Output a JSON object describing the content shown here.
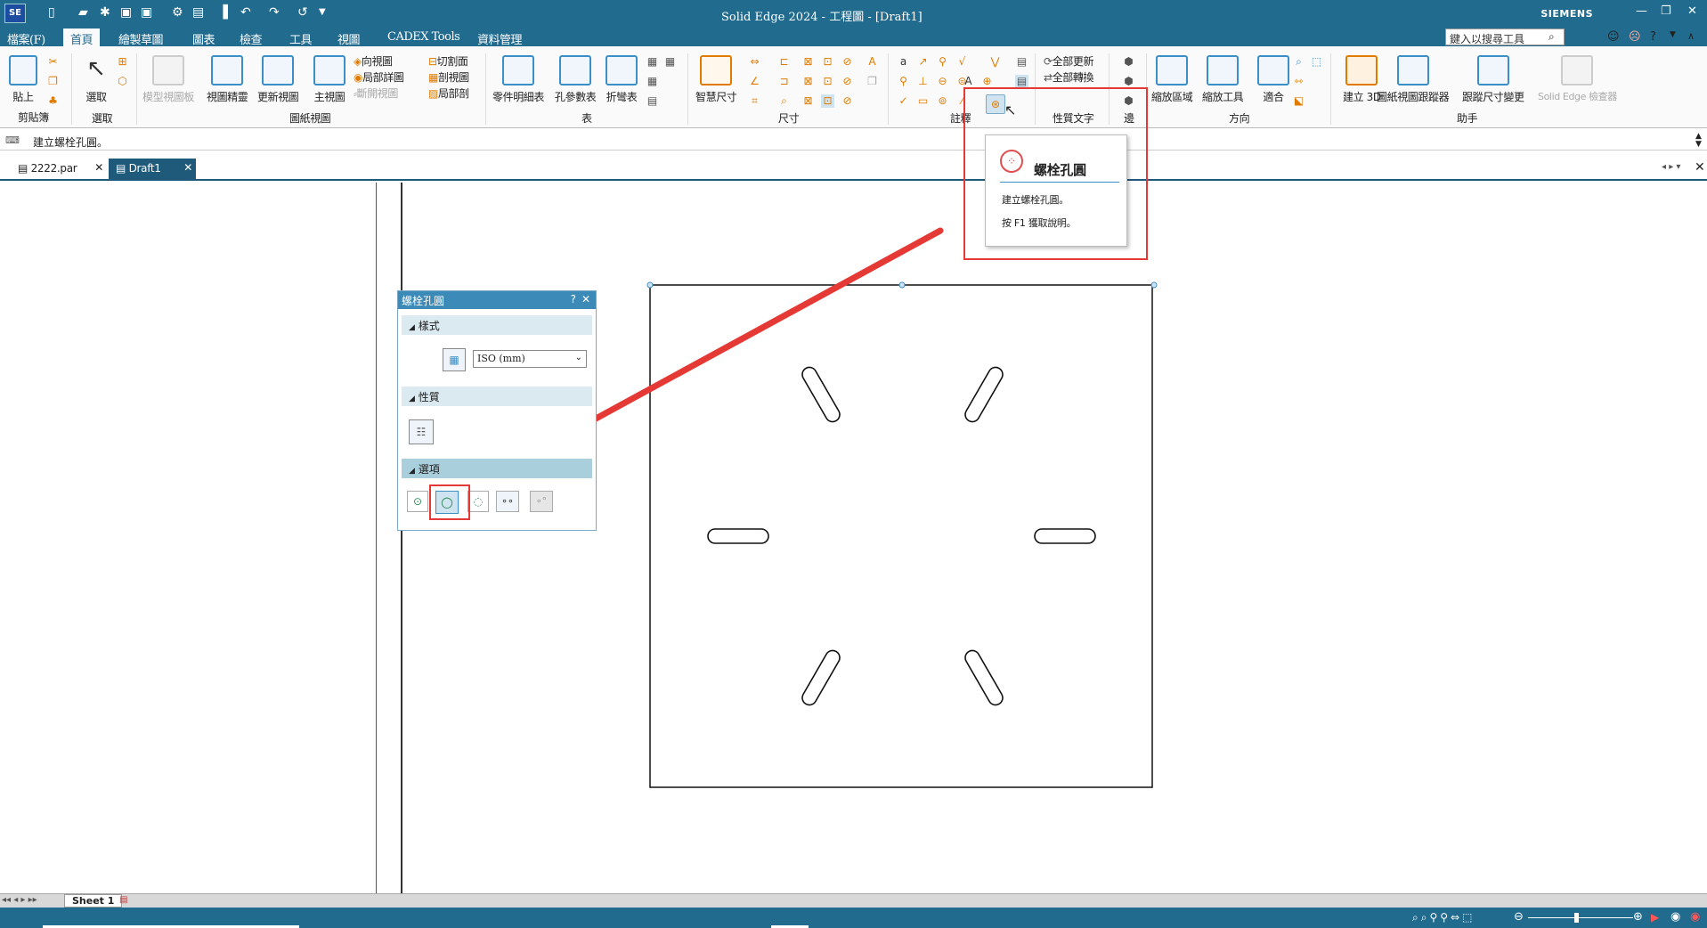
{
  "window": {
    "title": "Solid Edge 2024 - 工程圖 - [Draft1]",
    "brand": "SIEMENS",
    "app_icon": "SE"
  },
  "menu": {
    "file": "檔案(F)",
    "tabs": [
      "首頁",
      "繪製草圖",
      "圖表",
      "檢查",
      "工具",
      "視圖",
      "CADEX Tools",
      "資料管理"
    ],
    "active": "首頁",
    "search_placeholder": "鍵入以搜尋工具"
  },
  "ribbon": {
    "clipboard": {
      "paste": "貼上",
      "group": "剪貼簿"
    },
    "select": {
      "label": "選取",
      "group": "選取"
    },
    "drawing_views": {
      "model_view": "模型視圖板",
      "view_refine": "視圖精靈",
      "update_views": "更新視圖",
      "principal": "主視圖",
      "auxiliary": "向視圖",
      "detail": "局部詳圖",
      "broken_out": "斷開視圖",
      "section_plane": "切割面",
      "section": "剖視圖",
      "broken_section": "局部剖",
      "group": "圖紙視圖"
    },
    "tables": {
      "parts_list": "零件明細表",
      "hole_table": "孔參數表",
      "bend_table": "折彎表",
      "group": "表"
    },
    "dimension": {
      "smart": "智慧尺寸",
      "group": "尺寸"
    },
    "annotation": {
      "group": "註釋"
    },
    "property_text": {
      "update_all": "全部更新",
      "convert_all": "全部轉換",
      "group": "性質文字"
    },
    "edges": {
      "group": "邊"
    },
    "orient": {
      "zoom_area": "縮放區域",
      "zoom": "縮放工具",
      "fit": "適合",
      "group": "方向"
    },
    "assistants": {
      "create_3d": "建立 3D",
      "view_tracker": "圖紙視圖跟蹤器",
      "dim_change": "跟蹤尺寸變更",
      "inspector": "Solid Edge 檢查器",
      "group": "助手"
    }
  },
  "command_prompt": "建立螺栓孔圓。",
  "doc_tabs": [
    {
      "label": "2222.par",
      "active": false
    },
    {
      "label": "Draft1",
      "active": true
    }
  ],
  "panel": {
    "title": "螺栓孔圓",
    "sections": [
      "樣式",
      "性質",
      "選項"
    ],
    "style_value": "ISO (mm)"
  },
  "tooltip": {
    "title": "螺栓孔圓",
    "desc": "建立螺栓孔圓。",
    "help": "按 F1 獲取說明。"
  },
  "sheet_tab": "Sheet 1",
  "colors": {
    "accent": "#216b8f",
    "highlight": "#e53935"
  }
}
